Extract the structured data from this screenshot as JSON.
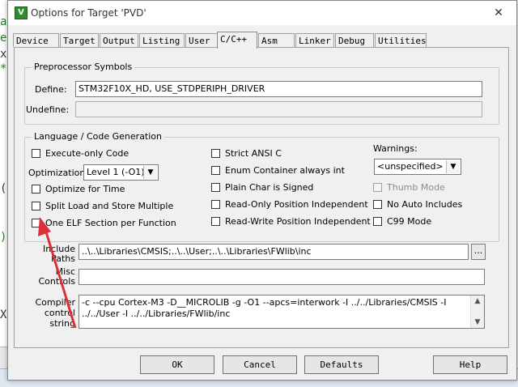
{
  "background": {
    "editor_chars": [
      "a",
      "e",
      "x",
      "*",
      "",
      "",
      "",
      "",
      "",
      "(",
      "",
      "",
      "",
      "",
      ")",
      "",
      "",
      "",
      "",
      "",
      "X"
    ]
  },
  "window": {
    "title": "Options for Target 'PVD'",
    "icon": "app-icon",
    "close": "✕"
  },
  "tabs": [
    "Device",
    "Target",
    "Output",
    "Listing",
    "User",
    "C/C++",
    "Asm",
    "Linker",
    "Debug",
    "Utilities"
  ],
  "active_tab": "C/C++",
  "preprocessor": {
    "group_title": "Preprocessor Symbols",
    "define_label": "Define:",
    "define_value": "STM32F10X_HD, USE_STDPERIPH_DRIVER",
    "undefine_label": "Undefine:",
    "undefine_value": ""
  },
  "language": {
    "group_title": "Language / Code Generation",
    "execute_only": "Execute-only Code",
    "optimization_label": "Optimization:",
    "optimization_value": "Level 1 (-O1)",
    "optimize_time": "Optimize for Time",
    "split_load": "Split Load and Store Multiple",
    "one_elf": "One ELF Section per Function",
    "strict_ansi": "Strict ANSI C",
    "enum_container": "Enum Container always int",
    "plain_char": "Plain Char is Signed",
    "ro_pi": "Read-Only Position Independent",
    "rw_pi": "Read-Write Position Independent",
    "warnings_label": "Warnings:",
    "warnings_value": "<unspecified>",
    "thumb_mode": "Thumb Mode",
    "no_auto_includes": "No Auto Includes",
    "c99_mode": "C99 Mode"
  },
  "include": {
    "label_line1": "Include",
    "label_line2": "Paths",
    "value": "..\\..\\Libraries\\CMSIS;..\\..\\User;..\\..\\Libraries\\FWlib\\inc",
    "browse": "..."
  },
  "misc": {
    "label_line1": "Misc",
    "label_line2": "Controls",
    "value": ""
  },
  "compiler": {
    "label_line1": "Compiler",
    "label_line2": "control",
    "label_line3": "string",
    "value": "-c --cpu Cortex-M3 -D__MICROLIB -g -O1 --apcs=interwork -I ../../Libraries/CMSIS -I ../../User -I ../../Libraries/FWlib/inc"
  },
  "buttons": {
    "ok": "OK",
    "cancel": "Cancel",
    "defaults": "Defaults",
    "help": "Help"
  },
  "colors": {
    "annotation_arrow": "#d9303a",
    "app_icon": "#2e8b2e"
  }
}
